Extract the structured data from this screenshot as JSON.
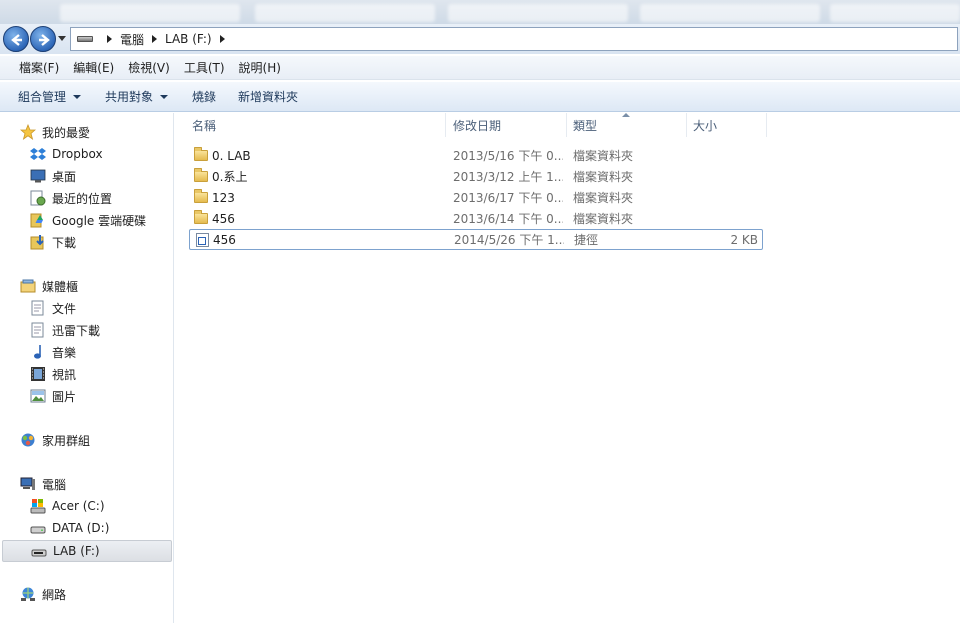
{
  "address": {
    "crumbs": [
      "電腦",
      "LAB (F:)"
    ]
  },
  "menubar": {
    "items": [
      "檔案(F)",
      "編輯(E)",
      "檢視(V)",
      "工具(T)",
      "說明(H)"
    ]
  },
  "commandbar": {
    "organize": "組合管理",
    "share": "共用對象",
    "burn": "燒錄",
    "new_folder": "新增資料夾"
  },
  "nav": {
    "favorites": {
      "label": "我的最愛",
      "items": [
        "Dropbox",
        "桌面",
        "最近的位置",
        "Google 雲端硬碟",
        "下載"
      ]
    },
    "libraries": {
      "label": "媒體櫃",
      "items": [
        "文件",
        "迅雷下載",
        "音樂",
        "視訊",
        "圖片"
      ]
    },
    "homegroup": {
      "label": "家用群組"
    },
    "computer": {
      "label": "電腦",
      "items": [
        "Acer (C:)",
        "DATA (D:)",
        "LAB (F:)"
      ]
    },
    "network": {
      "label": "網路"
    }
  },
  "columns": {
    "name": "名稱",
    "modified": "修改日期",
    "type": "類型",
    "size": "大小"
  },
  "files": [
    {
      "name": "0. LAB",
      "date": "2013/5/16 下午 0...",
      "type": "檔案資料夾",
      "size": "",
      "icon": "folder-icon"
    },
    {
      "name": "0.系上",
      "date": "2013/3/12 上午 1...",
      "type": "檔案資料夾",
      "size": "",
      "icon": "folder-icon"
    },
    {
      "name": "123",
      "date": "2013/6/17 下午 0...",
      "type": "檔案資料夾",
      "size": "",
      "icon": "folder-icon"
    },
    {
      "name": "456",
      "date": "2013/6/14 下午 0...",
      "type": "檔案資料夾",
      "size": "",
      "icon": "folder-icon"
    },
    {
      "name": "456",
      "date": "2014/5/26 下午 1...",
      "type": "捷徑",
      "size": "2 KB",
      "icon": "shortcut-icon"
    }
  ]
}
